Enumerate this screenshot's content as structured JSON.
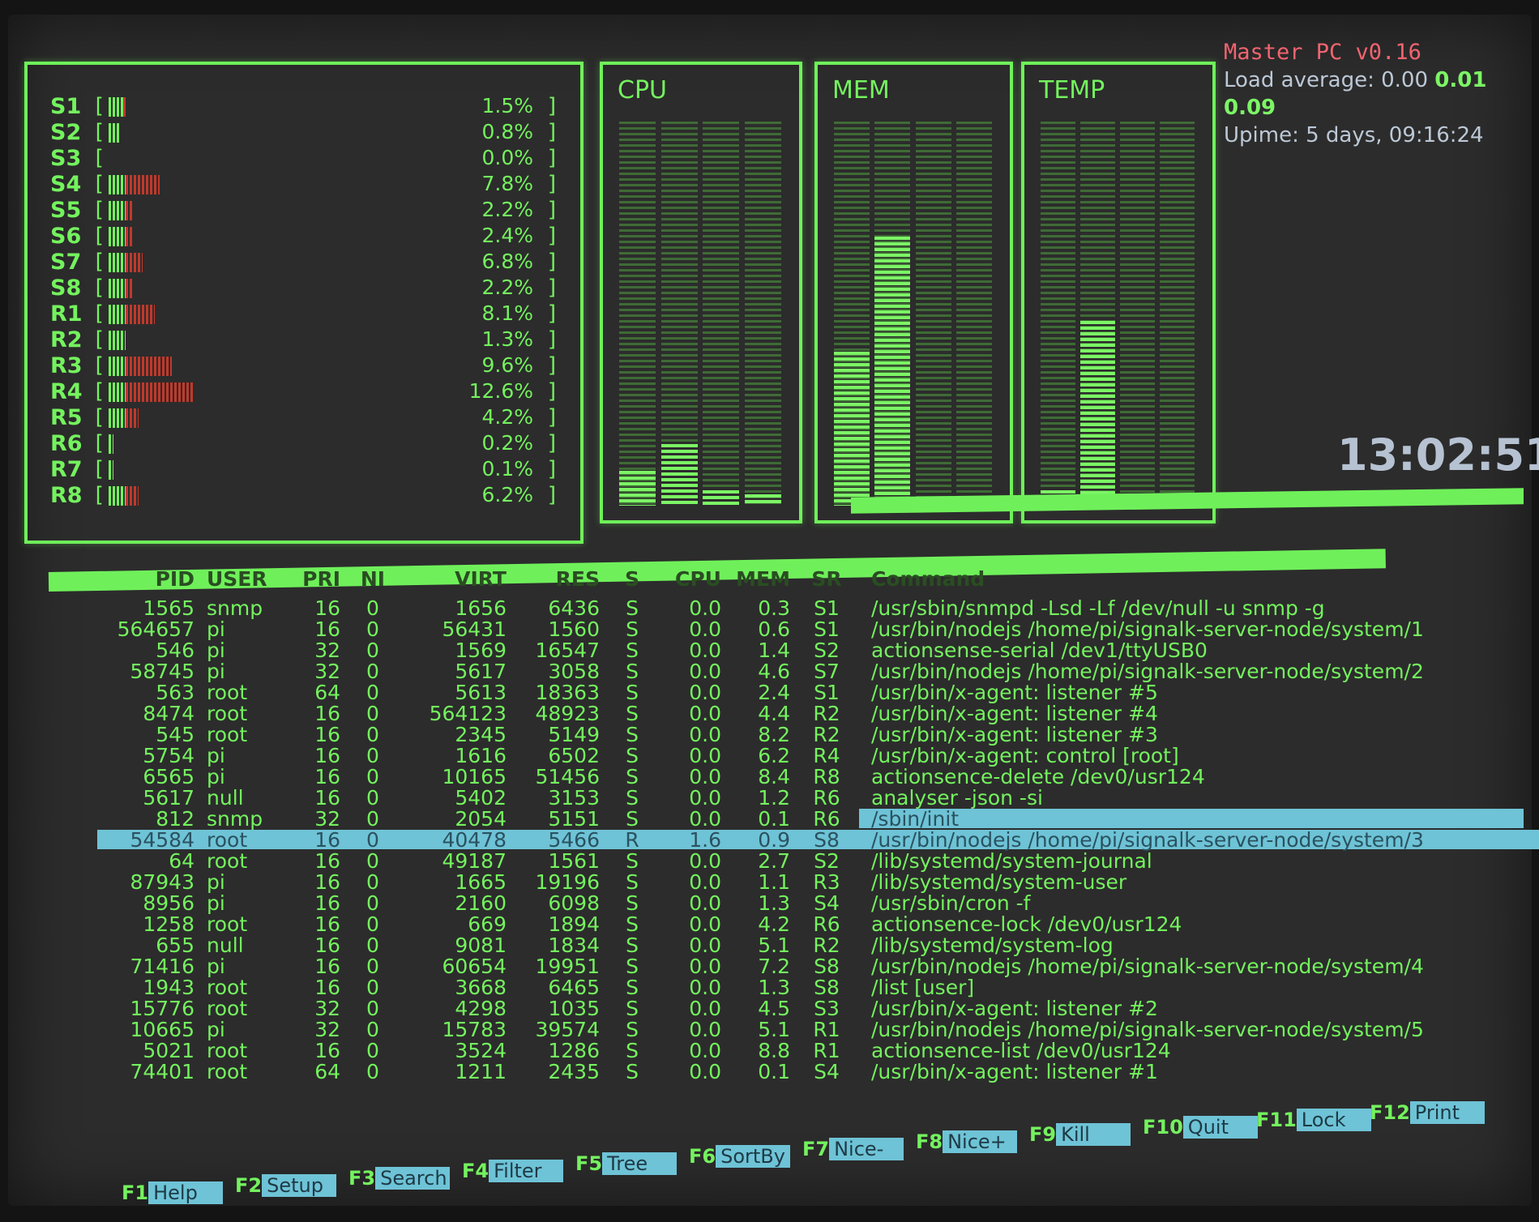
{
  "header": {
    "title": "Master PC v0.16",
    "load_label": "Load average:",
    "load_1": "0.00",
    "load_5": "0.01",
    "load_15": "0.09",
    "uptime": "Upime: 5 days, 09:16:24",
    "clock": "13:02:51"
  },
  "colors": {
    "phosphor": "#74f25e",
    "bar_red": "#c0392b",
    "highlight": "#6ec3d6",
    "title_red": "#f26470"
  },
  "cores": [
    {
      "name": "S1",
      "pct": "1.5%",
      "green": 0.035,
      "red": 0.01
    },
    {
      "name": "S2",
      "pct": "0.8%",
      "green": 0.025,
      "red": 0.0
    },
    {
      "name": "S3",
      "pct": "0.0%",
      "green": 0.0,
      "red": 0.0
    },
    {
      "name": "S4",
      "pct": "7.8%",
      "green": 0.04,
      "red": 0.08
    },
    {
      "name": "S5",
      "pct": "2.2%",
      "green": 0.04,
      "red": 0.02
    },
    {
      "name": "S6",
      "pct": "2.4%",
      "green": 0.04,
      "red": 0.015
    },
    {
      "name": "S7",
      "pct": "6.8%",
      "green": 0.04,
      "red": 0.04
    },
    {
      "name": "S8",
      "pct": "2.2%",
      "green": 0.04,
      "red": 0.015
    },
    {
      "name": "R1",
      "pct": "8.1%",
      "green": 0.04,
      "red": 0.07
    },
    {
      "name": "R2",
      "pct": "1.3%",
      "green": 0.04,
      "red": 0.0
    },
    {
      "name": "R3",
      "pct": "9.6%",
      "green": 0.04,
      "red": 0.11
    },
    {
      "name": "R4",
      "pct": "12.6%",
      "green": 0.04,
      "red": 0.16
    },
    {
      "name": "R5",
      "pct": "4.2%",
      "green": 0.04,
      "red": 0.03
    },
    {
      "name": "R6",
      "pct": "0.2%",
      "green": 0.012,
      "red": 0.0
    },
    {
      "name": "R7",
      "pct": "0.1%",
      "green": 0.012,
      "red": 0.0
    },
    {
      "name": "R8",
      "pct": "6.2%",
      "green": 0.04,
      "red": 0.03
    }
  ],
  "meters": {
    "cpu": {
      "label": "CPU",
      "levels": [
        0.09,
        0.16,
        0.04,
        0.03
      ]
    },
    "mem": {
      "label": "MEM",
      "levels": [
        0.4,
        0.7,
        0.02,
        0.02
      ]
    },
    "temp": {
      "label": "TEMP",
      "levels": [
        0.04,
        0.48,
        0.02,
        0.02
      ]
    }
  },
  "table": {
    "headers": {
      "pid": "PID",
      "user": "USER",
      "pri": "PRI",
      "ni": "NI",
      "virt": "VIRT",
      "res": "RES",
      "s": "S",
      "cpu": "CPU",
      "mem": "MEM",
      "sr": "SR",
      "cmd": "Command"
    },
    "rows": [
      [
        "1565",
        "snmp",
        "16",
        "0",
        "1656",
        "6436",
        "S",
        "0.0",
        "0.3",
        "S1",
        "/usr/sbin/snmpd -Lsd -Lf /dev/null -u snmp -g"
      ],
      [
        "564657",
        "pi",
        "16",
        "0",
        "56431",
        "1560",
        "S",
        "0.0",
        "0.6",
        "S1",
        "/usr/bin/nodejs /home/pi/signalk-server-node/system/1"
      ],
      [
        "546",
        "pi",
        "32",
        "0",
        "1569",
        "16547",
        "S",
        "0.0",
        "1.4",
        "S2",
        "actionsense-serial /dev1/ttyUSB0"
      ],
      [
        "58745",
        "pi",
        "32",
        "0",
        "5617",
        "3058",
        "S",
        "0.0",
        "4.6",
        "S7",
        "/usr/bin/nodejs /home/pi/signalk-server-node/system/2"
      ],
      [
        "563",
        "root",
        "64",
        "0",
        "5613",
        "18363",
        "S",
        "0.0",
        "2.4",
        "S1",
        "/usr/bin/x-agent: listener #5"
      ],
      [
        "8474",
        "root",
        "16",
        "0",
        "564123",
        "48923",
        "S",
        "0.0",
        "4.4",
        "R2",
        "/usr/bin/x-agent: listener #4"
      ],
      [
        "545",
        "root",
        "16",
        "0",
        "2345",
        "5149",
        "S",
        "0.0",
        "8.2",
        "R2",
        "/usr/bin/x-agent: listener #3"
      ],
      [
        "5754",
        "pi",
        "16",
        "0",
        "1616",
        "6502",
        "S",
        "0.0",
        "6.2",
        "R4",
        "/usr/bin/x-agent: control [root]"
      ],
      [
        "6565",
        "pi",
        "16",
        "0",
        "10165",
        "51456",
        "S",
        "0.0",
        "8.4",
        "R8",
        "actionsence-delete /dev0/usr124"
      ],
      [
        "5617",
        "null",
        "16",
        "0",
        "5402",
        "3153",
        "S",
        "0.0",
        "1.2",
        "R6",
        "analyser -json -si"
      ],
      [
        "812",
        "snmp",
        "32",
        "0",
        "2054",
        "5151",
        "S",
        "0.0",
        "0.1",
        "R6",
        "/sbin/init"
      ],
      [
        "54584",
        "root",
        "16",
        "0",
        "40478",
        "5466",
        "R",
        "1.6",
        "0.9",
        "S8",
        "/usr/bin/nodejs /home/pi/signalk-server-node/system/3"
      ],
      [
        "64",
        "root",
        "16",
        "0",
        "49187",
        "1561",
        "S",
        "0.0",
        "2.7",
        "S2",
        "/lib/systemd/system-journal"
      ],
      [
        "87943",
        "pi",
        "16",
        "0",
        "1665",
        "19196",
        "S",
        "0.0",
        "1.1",
        "R3",
        "/lib/systemd/system-user"
      ],
      [
        "8956",
        "pi",
        "16",
        "0",
        "2160",
        "6098",
        "S",
        "0.0",
        "1.3",
        "S4",
        "/usr/sbin/cron -f"
      ],
      [
        "1258",
        "root",
        "16",
        "0",
        "669",
        "1894",
        "S",
        "0.0",
        "4.2",
        "R6",
        "actionsence-lock /dev0/usr124"
      ],
      [
        "655",
        "null",
        "16",
        "0",
        "9081",
        "1834",
        "S",
        "0.0",
        "5.1",
        "R2",
        "/lib/systemd/system-log"
      ],
      [
        "71416",
        "pi",
        "16",
        "0",
        "60654",
        "19951",
        "S",
        "0.0",
        "7.2",
        "S8",
        "/usr/bin/nodejs /home/pi/signalk-server-node/system/4"
      ],
      [
        "1943",
        "root",
        "16",
        "0",
        "3668",
        "6465",
        "S",
        "0.0",
        "1.3",
        "S8",
        "/list [user]"
      ],
      [
        "15776",
        "root",
        "32",
        "0",
        "4298",
        "1035",
        "S",
        "0.0",
        "4.5",
        "S3",
        "/usr/bin/x-agent: listener #2"
      ],
      [
        "10665",
        "pi",
        "32",
        "0",
        "15783",
        "39574",
        "S",
        "0.0",
        "5.1",
        "R1",
        "/usr/bin/nodejs /home/pi/signalk-server-node/system/5"
      ],
      [
        "5021",
        "root",
        "16",
        "0",
        "3524",
        "1286",
        "S",
        "0.0",
        "8.8",
        "R1",
        "actionsence-list /dev0/usr124"
      ],
      [
        "74401",
        "root",
        "64",
        "0",
        "1211",
        "2435",
        "S",
        "0.0",
        "0.1",
        "S4",
        "/usr/bin/x-agent: listener #1"
      ]
    ]
  },
  "fkeys": [
    {
      "key": "F1",
      "label": "Help"
    },
    {
      "key": "F2",
      "label": "Setup"
    },
    {
      "key": "F3",
      "label": "Search"
    },
    {
      "key": "F4",
      "label": "Filter"
    },
    {
      "key": "F5",
      "label": "Tree"
    },
    {
      "key": "F6",
      "label": "SortBy"
    },
    {
      "key": "F7",
      "label": "Nice-"
    },
    {
      "key": "F8",
      "label": "Nice+"
    },
    {
      "key": "F9",
      "label": "Kill"
    },
    {
      "key": "F10",
      "label": "Quit"
    },
    {
      "key": "F11",
      "label": "Lock"
    },
    {
      "key": "F12",
      "label": "Print"
    }
  ]
}
